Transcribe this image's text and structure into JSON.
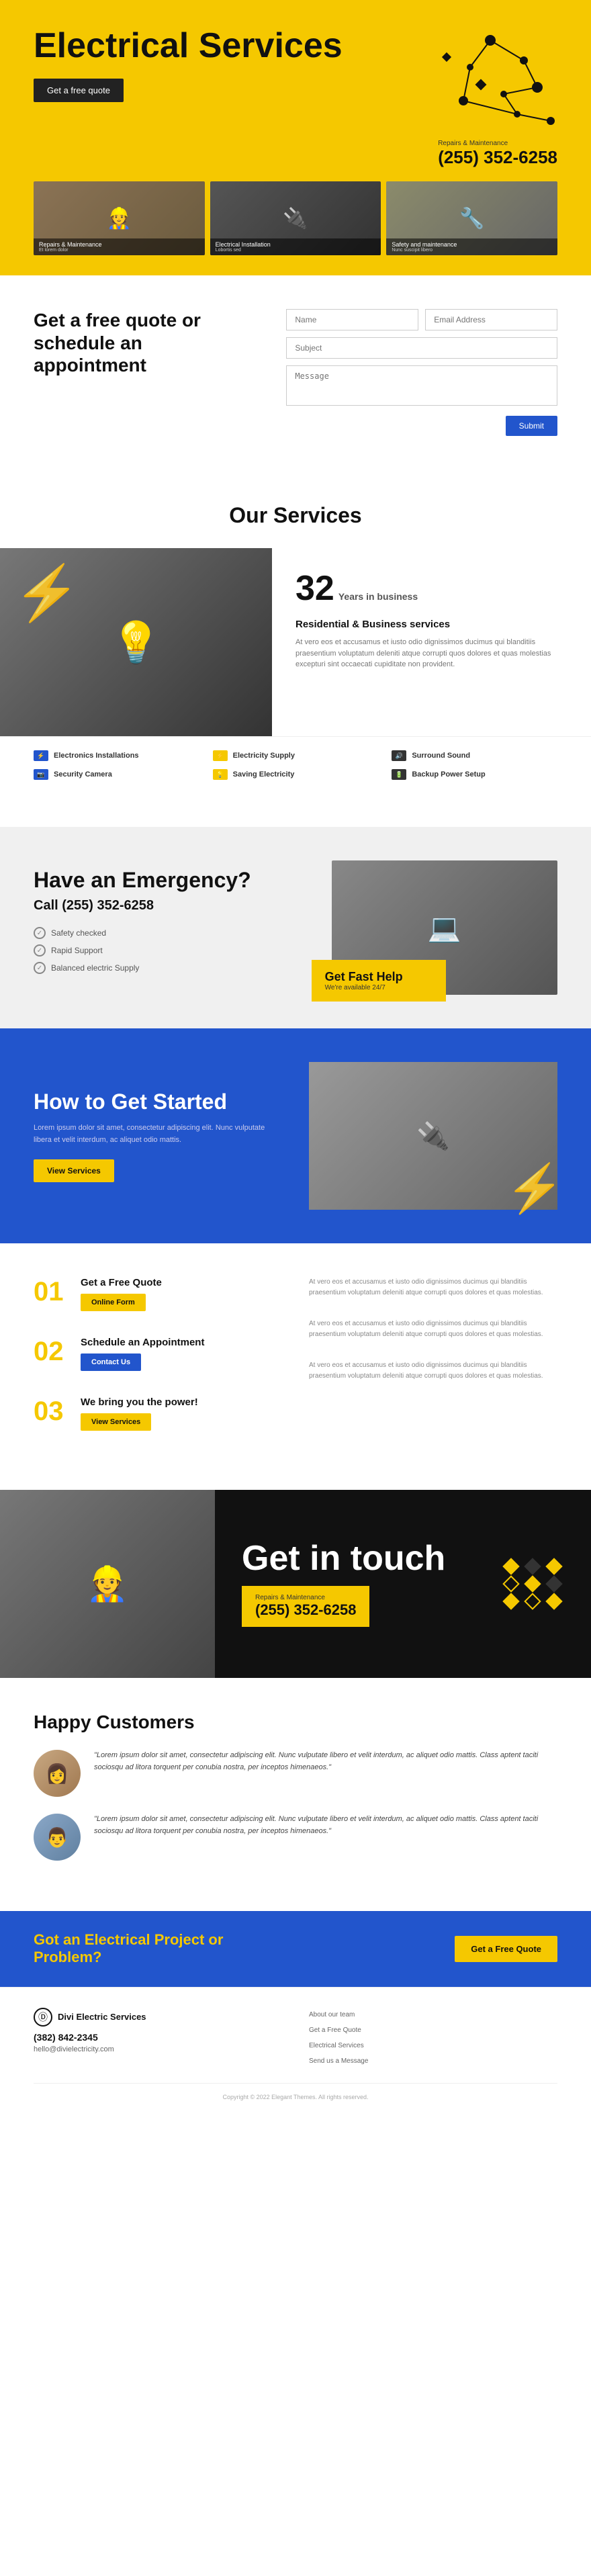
{
  "hero": {
    "title": "Electrical Services",
    "cta_button": "Get a free quote",
    "repairs_label": "Repairs & Maintenance",
    "phone": "(255) 352-6258",
    "images": [
      {
        "label": "Repairs & Maintenance",
        "sublabel": "Et lorem dolor"
      },
      {
        "label": "Electrical Installation",
        "sublabel": "Lobortis sed"
      },
      {
        "label": "Safety and maintenance",
        "sublabel": "Nunc suscipit libero"
      }
    ]
  },
  "quote": {
    "heading": "Get a free quote or schedule an appointment",
    "name_placeholder": "Name",
    "email_placeholder": "Email Address",
    "subject_placeholder": "Subject",
    "message_placeholder": "Message",
    "submit_label": "Submit"
  },
  "services": {
    "section_title": "Our Services",
    "years_number": "32",
    "years_label": "Years in business",
    "subtitle": "Residential & Business services",
    "description": "At vero eos et accusamus et iusto odio dignissimos ducimus qui blanditiis praesentium voluptatum deleniti atque corrupti quos dolores et quas molestias excepturi sint occaecati cupiditate non provident.",
    "items": [
      {
        "label": "Electronics Installations",
        "icon_type": "blue"
      },
      {
        "label": "Electricity Supply",
        "icon_type": "yellow"
      },
      {
        "label": "Surround Sound",
        "icon_type": "dark"
      },
      {
        "label": "Security Camera",
        "icon_type": "blue"
      },
      {
        "label": "Saving Electricity",
        "icon_type": "yellow"
      },
      {
        "label": "Backup Power Setup",
        "icon_type": "dark"
      }
    ]
  },
  "emergency": {
    "heading": "Have an Emergency?",
    "phone": "Call (255) 352-6258",
    "checklist": [
      "Safety checked",
      "Rapid Support",
      "Balanced electric Supply"
    ],
    "fast_help_title": "Get Fast Help",
    "fast_help_sub": "We're available 24/7"
  },
  "howto": {
    "heading": "How to Get Started",
    "description": "Lorem ipsum dolor sit amet, consectetur adipiscing elit. Nunc vulputate libera et velit interdum, ac aliquet odio mattis.",
    "button_label": "View Services"
  },
  "steps": [
    {
      "number": "01",
      "title": "Get a Free Quote",
      "button_label": "Online Form",
      "button_type": "yellow",
      "description": "At vero eos et accusamus et iusto odio dignissimos ducimus qui blanditiis praesentium voluptatum deleniti atque corrupti quos dolores et quas molestias."
    },
    {
      "number": "02",
      "title": "Schedule an Appointment",
      "button_label": "Contact Us",
      "button_type": "blue",
      "description": "At vero eos et accusamus et iusto odio dignissimos ducimus qui blanditiis praesentium voluptatum deleniti atque corrupti quos dolores et quas molestias."
    },
    {
      "number": "03",
      "title": "We bring you the power!",
      "button_label": "View Services",
      "button_type": "yellow",
      "description": "At vero eos et accusamus et iusto odio dignissimos ducimus qui blanditiis praesentium voluptatum deleniti atque corrupti quos dolores et quas molestias."
    }
  ],
  "touch": {
    "heading": "Get in touch",
    "repairs_label": "Repairs & Maintenance",
    "phone": "(255) 352-6258"
  },
  "testimonials": {
    "section_title": "Happy Customers",
    "items": [
      {
        "text": "\"Lorem ipsum dolor sit amet, consectetur adipiscing elit. Nunc vulputate libero et velit interdum, ac aliquet odio mattis. Class aptent taciti sociosqu ad litora torquent per conubia nostra, per inceptos himenaeos.\"",
        "avatar_type": "woman"
      },
      {
        "text": "\"Lorem ipsum dolor sit amet, consectetur adipiscing elit. Nunc vulputate libero et velit interdum, ac aliquet odio mattis. Class aptent taciti sociosqu ad litora torquent per conubia nostra, per inceptos himenaeos.\"",
        "avatar_type": "man"
      }
    ]
  },
  "cta": {
    "text": "Got an Electrical Project or Problem?",
    "button_label": "Get a Free Quote"
  },
  "footer": {
    "brand_name": "Divi Electric Services",
    "phone": "(382) 842-2345",
    "email": "hello@divielectricity.com",
    "nav_links": [
      "About our team",
      "Get a Free Quote",
      "Electrical Services",
      "Send us a Message"
    ],
    "copyright": "Copyright © 2022 Elegant Themes. All rights reserved."
  }
}
